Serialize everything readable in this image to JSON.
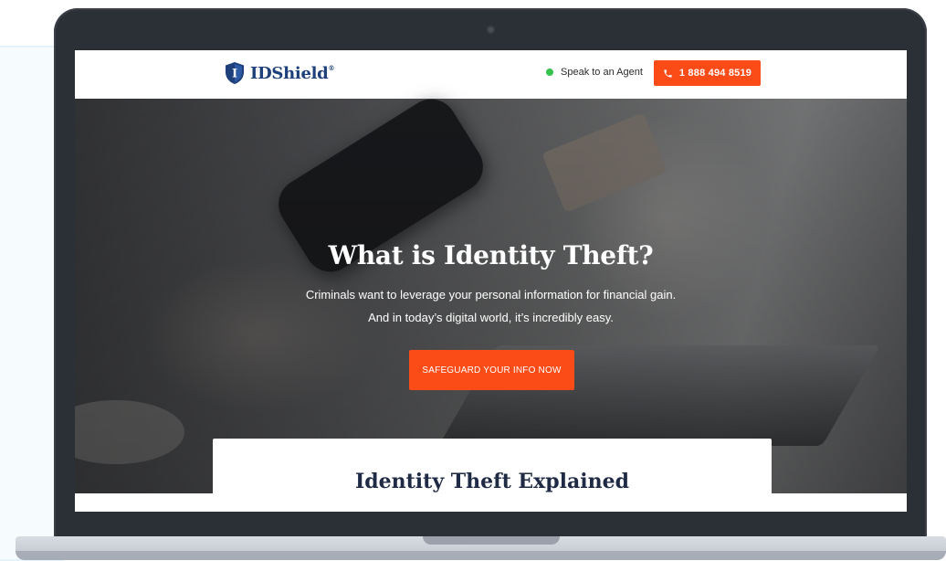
{
  "brand": {
    "name": "IDShield",
    "registered_mark": "®",
    "shield_letter": "I",
    "colors": {
      "navy": "#1d3f7a",
      "accent": "#fb4b17",
      "online": "#35c24c"
    }
  },
  "header": {
    "agent_label": "Speak to an Agent",
    "agent_status_icon": "online-dot-icon",
    "phone_icon": "phone-icon",
    "phone_number": "1 888 494 8519"
  },
  "hero": {
    "title": "What is Identity Theft?",
    "subtitle_line1": "Criminals want to leverage your personal information for financial gain.",
    "subtitle_line2": "And in today’s digital world, it’s incredibly easy.",
    "cta_label": "SAFEGUARD YOUR INFO NOW"
  },
  "section": {
    "title": "Identity Theft Explained"
  }
}
